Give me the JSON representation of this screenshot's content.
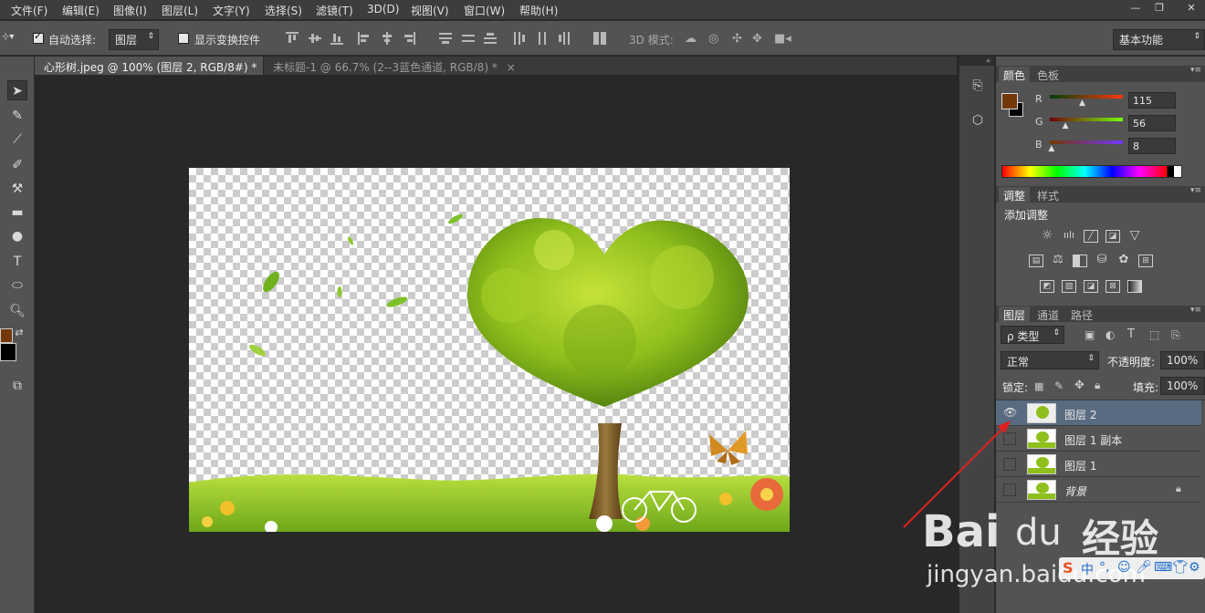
{
  "menu": [
    "文件(F)",
    "编辑(E)",
    "图像(I)",
    "图层(L)",
    "文字(Y)",
    "选择(S)",
    "滤镜(T)",
    "3D(D)",
    "视图(V)",
    "窗口(W)",
    "帮助(H)"
  ],
  "window_controls": {
    "minimize": "—",
    "restore": "❐",
    "close": "✕"
  },
  "options": {
    "auto_select_label": "自动选择:",
    "auto_select_target": "图层",
    "show_transform_label": "显示变换控件",
    "mode_3d_label": "3D 模式:",
    "workspace": "基本功能"
  },
  "doc_tabs": [
    {
      "title": "心形树.jpeg @ 100% (图层 2, RGB/8#) *",
      "close": "×"
    },
    {
      "title": "未标题-1 @ 66.7% (2--3蓝色通道, RGB/8) *",
      "close": "×"
    }
  ],
  "color_panel": {
    "tabs": [
      "颜色",
      "色板"
    ],
    "r_label": "R",
    "g_label": "G",
    "b_label": "B",
    "r": "115",
    "g": "56",
    "b": "8",
    "r_fraction": 0.45,
    "g_fraction": 0.22,
    "b_fraction": 0.03,
    "foreground": "#733808",
    "background": "#000000"
  },
  "adjust_panel": {
    "tabs": [
      "调整",
      "样式"
    ],
    "add_label": "添加调整",
    "icons": [
      "brightness-icon",
      "levels-icon",
      "curves-icon",
      "exposure-icon",
      "vibrance-icon",
      "hue-saturation-icon",
      "color-balance-icon",
      "black-white-icon",
      "photo-filter-icon",
      "channel-mixer-icon",
      "color-lookup-icon",
      "invert-icon",
      "posterize-icon",
      "threshold-icon",
      "gradient-map-icon"
    ]
  },
  "layers_panel": {
    "tabs": [
      "图层",
      "通道",
      "路径"
    ],
    "filter_kind": "ρ 类型",
    "blend_mode": "正常",
    "opacity_label": "不透明度:",
    "opacity": "100%",
    "lock_label": "锁定:",
    "fill_label": "填充:",
    "fill": "100%",
    "layers": [
      {
        "name": "图层 2",
        "visible": true,
        "selected": true,
        "locked": false
      },
      {
        "name": "图层 1 副本",
        "visible": false,
        "selected": false,
        "locked": false
      },
      {
        "name": "图层 1",
        "visible": false,
        "selected": false,
        "locked": false
      },
      {
        "name": "背景",
        "visible": false,
        "selected": false,
        "locked": true
      }
    ]
  },
  "watermark": {
    "brand": "Bai",
    "brand2": "经验",
    "url": "jingyan.baidu.com"
  },
  "toolbar_tools": [
    "move-tool-icon",
    "quick-select-icon",
    "eyedropper-icon",
    "brush-icon",
    "clone-stamp-icon",
    "gradient-icon",
    "dodge-icon",
    "type-tool-icon",
    "ellipse-icon",
    "zoom-icon",
    "swap-colors-icon",
    "screen-mode-icon"
  ]
}
